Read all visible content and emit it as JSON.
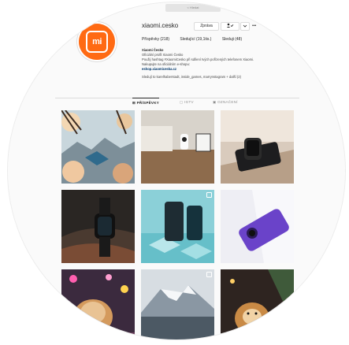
{
  "window": {
    "title": "< Hledat"
  },
  "profile": {
    "logo_text": "mi",
    "handle": "xiaomi.cesko",
    "message_button": "Zpráva",
    "follow_icon": "person-check-icon",
    "more_label": "•••",
    "stats": {
      "posts": "Příspěvky (218)",
      "followers": "Sledující (19,1tis.)",
      "following": "Sleduji (48)"
    },
    "bio": {
      "name": "Xiaomi Česko",
      "line1": "Oficiální profil Xiaomi Česko",
      "line2": "Použij hashtag #XiaomiCesko při sdílení tvých pořízených telefonem Xiaomi.",
      "line3": "Nakupujte na oficiálním e-shopu:",
      "link": "eshop.xiaomiceska.cz",
      "followed_by": "Sledují to karelhaberstadt, inside_games, marrynstagram + další (2)"
    }
  },
  "tabs": [
    {
      "label": "PŘÍSPĚVKY",
      "active": true
    },
    {
      "label": "IGTV",
      "active": false
    },
    {
      "label": "OZNAČENÍ",
      "active": false
    }
  ],
  "colors": {
    "brand": "#ff6a13",
    "link": "#00376b",
    "border": "#dbdbdb"
  },
  "posts": [
    {
      "subject": "flowers and mountains",
      "multi": false
    },
    {
      "subject": "camera on shelf",
      "multi": false
    },
    {
      "subject": "smartwatch on table",
      "multi": false
    },
    {
      "subject": "smartwatch on rock",
      "multi": false
    },
    {
      "subject": "phone on teal blocks",
      "multi": true
    },
    {
      "subject": "purple phone",
      "multi": false
    },
    {
      "subject": "dog with lights",
      "multi": false
    },
    {
      "subject": "snowy mountain lake",
      "multi": true
    },
    {
      "subject": "dog with christmas tree",
      "multi": false
    }
  ]
}
